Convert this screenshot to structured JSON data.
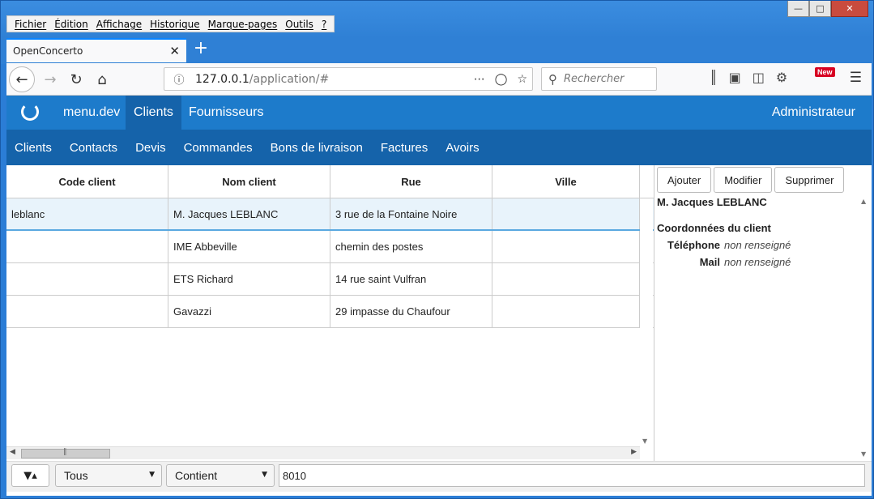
{
  "browser": {
    "menu": [
      "Fichier",
      "Édition",
      "Affichage",
      "Historique",
      "Marque-pages",
      "Outils",
      "?"
    ],
    "tab_title": "OpenConcerto",
    "url_host": "127.0.0.1",
    "url_path": "/application/#",
    "search_placeholder": "Rechercher",
    "new_badge": "New"
  },
  "app": {
    "top_nav": [
      "menu.dev",
      "Clients",
      "Fournisseurs"
    ],
    "active_top": "Clients",
    "user": "Administrateur",
    "sub_nav": [
      "Clients",
      "Contacts",
      "Devis",
      "Commandes",
      "Bons de livraison",
      "Factures",
      "Avoirs"
    ]
  },
  "table": {
    "columns": [
      "Code client",
      "Nom client",
      "Rue",
      "Ville"
    ],
    "rows": [
      [
        "leblanc",
        "M. Jacques LEBLANC",
        "3 rue de la Fontaine Noire",
        ""
      ],
      [
        "",
        "IME Abbeville",
        "chemin des postes",
        ""
      ],
      [
        "",
        "ETS Richard",
        "14 rue saint Vulfran",
        ""
      ],
      [
        "",
        "Gavazzi",
        "29 impasse du Chaufour",
        ""
      ]
    ],
    "selected_row": 0
  },
  "detail": {
    "buttons": [
      "Ajouter",
      "Modifier",
      "Supprimer"
    ],
    "name": "M. Jacques LEBLANC",
    "section": "Coordonnées du client",
    "fields": [
      {
        "label": "Téléphone",
        "value": "non renseigné"
      },
      {
        "label": "Mail",
        "value": "non renseigné"
      }
    ]
  },
  "filter": {
    "scope": "Tous",
    "mode": "Contient",
    "value": "8010"
  },
  "colors": {
    "app_top": "#1d7bcb",
    "app_sub": "#1563aa",
    "selected_row": "#e8f3fb"
  }
}
